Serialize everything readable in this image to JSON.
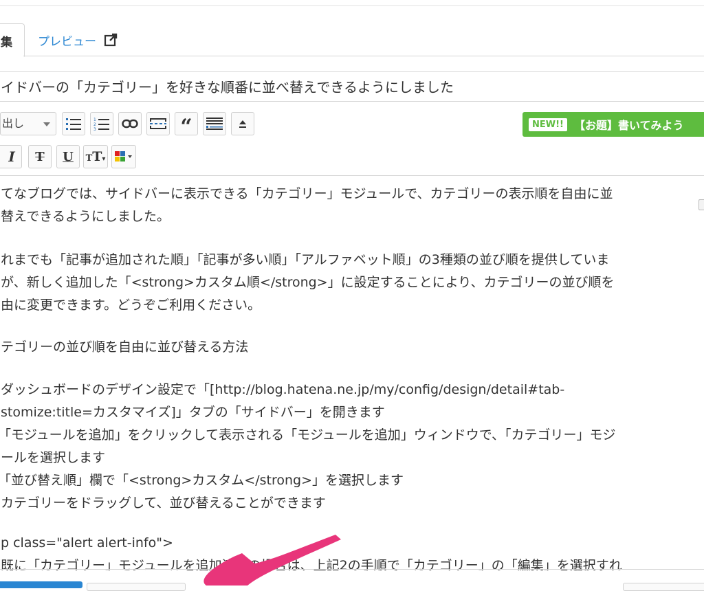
{
  "tabs": {
    "edit_label": "集",
    "preview_label": "プレビュー"
  },
  "title_value": "イドバーの「カテゴリー」を好きな順番に並べ替えできるようにしました",
  "toolbar": {
    "heading_select": "出し",
    "new_badge": "NEW!!",
    "new_text": "【お題】書いてみよう",
    "icons": [
      "list-bulleted-icon",
      "list-numbered-icon",
      "link-icon",
      "more-separator-icon",
      "blockquote-icon",
      "table-of-contents-icon",
      "upload-icon",
      "italic-icon",
      "strikethrough-icon",
      "underline-icon",
      "text-size-icon",
      "color-palette-icon"
    ]
  },
  "content": {
    "lines": [
      "てなブログでは、サイドバーに表示できる「カテゴリー」モジュールで、カテゴリーの表示順を自由に並",
      "替えできるようにしました。",
      "",
      "れまでも「記事が追加された順」「記事が多い順」「アルファベット順」の3種類の並び順を提供していま",
      "が、新しく追加した「<strong>カスタム順</strong>」に設定することにより、カテゴリーの並び順を",
      "由に変更できます。どうぞご利用ください。",
      "",
      "テゴリーの並び順を自由に並び替える方法",
      "",
      "ダッシュボードのデザイン設定で「[http://blog.hatena.ne.jp/my/config/design/detail#tab-",
      "stomize:title=カスタマイズ]」タブの「サイドバー」を開きます",
      "「モジュールを追加」をクリックして表示される「モジュールを追加」ウィンドウで、「カテゴリー」モジ",
      "ールを選択します",
      "「並び替え順」欄で「<strong>カスタム</strong>」を選択します",
      "カテゴリーをドラッグして、並び替えることができます",
      "",
      "p class=\"alert alert-info\">",
      "既に「カテゴリー」モジュールを追加済みの場合は、上記2の手順で「カテゴリー」の「編集」を選択すれ"
    ]
  },
  "colors": {
    "link_blue": "#2a86d2",
    "new_green": "#5ebc3f",
    "arrow_pink": "#e8357a"
  }
}
